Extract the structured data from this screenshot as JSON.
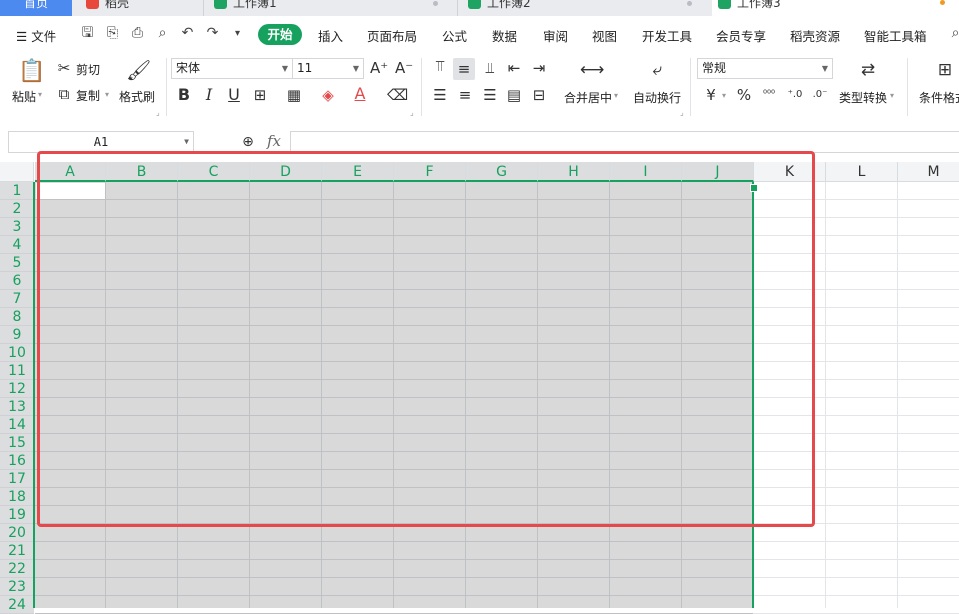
{
  "tabs": [
    {
      "label": "首页",
      "active": false
    },
    {
      "label": "稻壳",
      "active": false
    },
    {
      "label": "工作簿1",
      "active": false
    },
    {
      "label": "工作簿2",
      "active": false
    },
    {
      "label": "工作簿3",
      "active": true
    }
  ],
  "menu": {
    "file_label": "文件",
    "items": [
      "开始",
      "插入",
      "页面布局",
      "公式",
      "数据",
      "审阅",
      "视图",
      "开发工具",
      "会员专享",
      "稻壳资源",
      "智能工具箱"
    ],
    "active_item": "开始"
  },
  "ribbon": {
    "paste_label": "粘贴",
    "cut_label": "剪切",
    "copy_label": "复制",
    "format_painter_label": "格式刷",
    "font_name": "宋体",
    "font_size": "11",
    "bold_glyph": "B",
    "italic_glyph": "I",
    "underline_glyph": "U",
    "font_color_glyph": "A",
    "merge_label": "合并居中",
    "wrap_label": "自动换行",
    "number_format": "常规",
    "currency_glyph": "¥",
    "percent_glyph": "%",
    "type_convert_label": "类型转换",
    "conditional_format_label": "条件格式"
  },
  "formula_bar": {
    "cell_ref": "A1",
    "fx_label": "fx",
    "formula_value": ""
  },
  "sheet": {
    "columns": [
      "A",
      "B",
      "C",
      "D",
      "E",
      "F",
      "G",
      "H",
      "I",
      "J",
      "K",
      "L",
      "M"
    ],
    "rows": [
      "1",
      "2",
      "3",
      "4",
      "5",
      "6",
      "7",
      "8",
      "9",
      "10",
      "11",
      "12",
      "13",
      "14",
      "15",
      "16",
      "17",
      "18",
      "19",
      "20",
      "21",
      "22",
      "23",
      "24"
    ],
    "selected_range": "A1:J24",
    "active_cell": "A1"
  },
  "colors": {
    "accent_green": "#16a15e",
    "highlight_red": "#e5494b",
    "home_tab_blue": "#4d8af0",
    "selection_fill": "#d9d9d9"
  }
}
